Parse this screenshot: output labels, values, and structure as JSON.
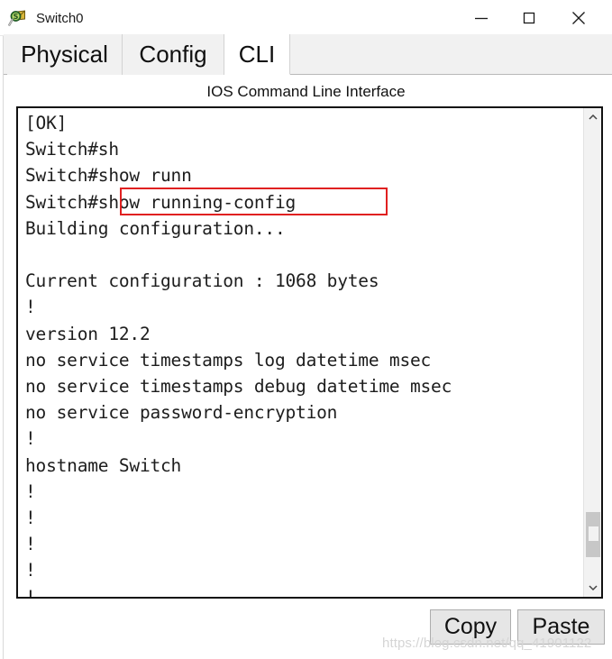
{
  "window": {
    "title": "Switch0",
    "icon": "switch-device-icon",
    "controls": {
      "minimize": "minimize-icon",
      "maximize": "maximize-icon",
      "close": "close-icon"
    }
  },
  "tabs": [
    {
      "label": "Physical",
      "active": false
    },
    {
      "label": "Config",
      "active": false
    },
    {
      "label": "CLI",
      "active": true
    }
  ],
  "cli": {
    "heading": "IOS Command Line Interface",
    "terminal_lines": [
      "[OK]",
      "Switch#sh",
      "Switch#show runn",
      "Switch#show running-config",
      "Building configuration...",
      "",
      "Current configuration : 1068 bytes",
      "!",
      "version 12.2",
      "no service timestamps log datetime msec",
      "no service timestamps debug datetime msec",
      "no service password-encryption",
      "!",
      "hostname Switch",
      "!",
      "!",
      "!",
      "!",
      "!"
    ],
    "terminal_text": "[OK]\nSwitch#sh\nSwitch#show runn\nSwitch#show running-config\nBuilding configuration...\n\nCurrent configuration : 1068 bytes\n!\nversion 12.2\nno service timestamps log datetime msec\nno service timestamps debug datetime msec\nno service password-encryption\n!\nhostname Switch\n!\n!\n!\n!\n!",
    "annotation": {
      "target_text": "show running-config",
      "color": "#e02020"
    },
    "scrollbar": {
      "up_arrow": "chevron-up-icon",
      "down_arrow": "chevron-down-icon",
      "thumb_position_percent": 84
    }
  },
  "buttons": {
    "copy": "Copy",
    "paste": "Paste"
  },
  "watermark": "https://blog.csdn.net/qq_41901122"
}
